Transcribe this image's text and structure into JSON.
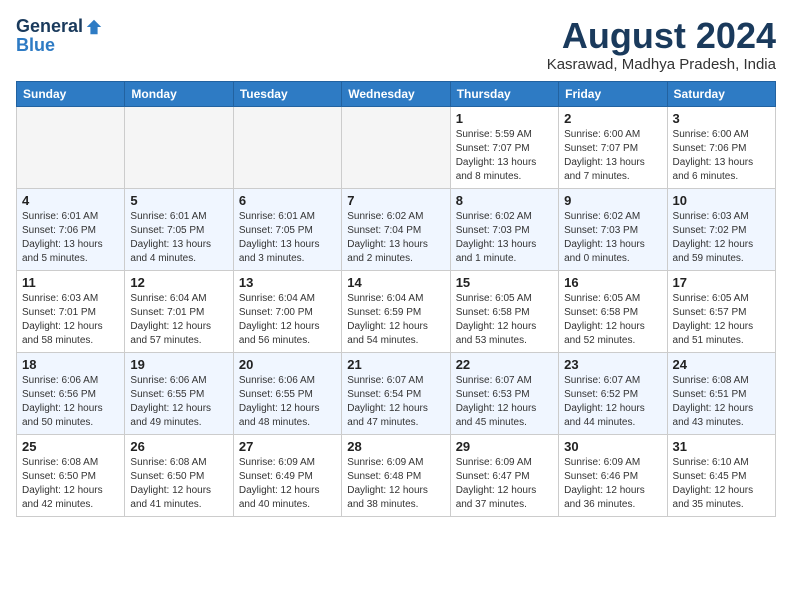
{
  "header": {
    "logo": {
      "line1": "General",
      "line2": "Blue"
    },
    "month_year": "August 2024",
    "location": "Kasrawad, Madhya Pradesh, India"
  },
  "weekdays": [
    "Sunday",
    "Monday",
    "Tuesday",
    "Wednesday",
    "Thursday",
    "Friday",
    "Saturday"
  ],
  "weeks": [
    [
      {
        "day": "",
        "info": ""
      },
      {
        "day": "",
        "info": ""
      },
      {
        "day": "",
        "info": ""
      },
      {
        "day": "",
        "info": ""
      },
      {
        "day": "1",
        "info": "Sunrise: 5:59 AM\nSunset: 7:07 PM\nDaylight: 13 hours\nand 8 minutes."
      },
      {
        "day": "2",
        "info": "Sunrise: 6:00 AM\nSunset: 7:07 PM\nDaylight: 13 hours\nand 7 minutes."
      },
      {
        "day": "3",
        "info": "Sunrise: 6:00 AM\nSunset: 7:06 PM\nDaylight: 13 hours\nand 6 minutes."
      }
    ],
    [
      {
        "day": "4",
        "info": "Sunrise: 6:01 AM\nSunset: 7:06 PM\nDaylight: 13 hours\nand 5 minutes."
      },
      {
        "day": "5",
        "info": "Sunrise: 6:01 AM\nSunset: 7:05 PM\nDaylight: 13 hours\nand 4 minutes."
      },
      {
        "day": "6",
        "info": "Sunrise: 6:01 AM\nSunset: 7:05 PM\nDaylight: 13 hours\nand 3 minutes."
      },
      {
        "day": "7",
        "info": "Sunrise: 6:02 AM\nSunset: 7:04 PM\nDaylight: 13 hours\nand 2 minutes."
      },
      {
        "day": "8",
        "info": "Sunrise: 6:02 AM\nSunset: 7:03 PM\nDaylight: 13 hours\nand 1 minute."
      },
      {
        "day": "9",
        "info": "Sunrise: 6:02 AM\nSunset: 7:03 PM\nDaylight: 13 hours\nand 0 minutes."
      },
      {
        "day": "10",
        "info": "Sunrise: 6:03 AM\nSunset: 7:02 PM\nDaylight: 12 hours\nand 59 minutes."
      }
    ],
    [
      {
        "day": "11",
        "info": "Sunrise: 6:03 AM\nSunset: 7:01 PM\nDaylight: 12 hours\nand 58 minutes."
      },
      {
        "day": "12",
        "info": "Sunrise: 6:04 AM\nSunset: 7:01 PM\nDaylight: 12 hours\nand 57 minutes."
      },
      {
        "day": "13",
        "info": "Sunrise: 6:04 AM\nSunset: 7:00 PM\nDaylight: 12 hours\nand 56 minutes."
      },
      {
        "day": "14",
        "info": "Sunrise: 6:04 AM\nSunset: 6:59 PM\nDaylight: 12 hours\nand 54 minutes."
      },
      {
        "day": "15",
        "info": "Sunrise: 6:05 AM\nSunset: 6:58 PM\nDaylight: 12 hours\nand 53 minutes."
      },
      {
        "day": "16",
        "info": "Sunrise: 6:05 AM\nSunset: 6:58 PM\nDaylight: 12 hours\nand 52 minutes."
      },
      {
        "day": "17",
        "info": "Sunrise: 6:05 AM\nSunset: 6:57 PM\nDaylight: 12 hours\nand 51 minutes."
      }
    ],
    [
      {
        "day": "18",
        "info": "Sunrise: 6:06 AM\nSunset: 6:56 PM\nDaylight: 12 hours\nand 50 minutes."
      },
      {
        "day": "19",
        "info": "Sunrise: 6:06 AM\nSunset: 6:55 PM\nDaylight: 12 hours\nand 49 minutes."
      },
      {
        "day": "20",
        "info": "Sunrise: 6:06 AM\nSunset: 6:55 PM\nDaylight: 12 hours\nand 48 minutes."
      },
      {
        "day": "21",
        "info": "Sunrise: 6:07 AM\nSunset: 6:54 PM\nDaylight: 12 hours\nand 47 minutes."
      },
      {
        "day": "22",
        "info": "Sunrise: 6:07 AM\nSunset: 6:53 PM\nDaylight: 12 hours\nand 45 minutes."
      },
      {
        "day": "23",
        "info": "Sunrise: 6:07 AM\nSunset: 6:52 PM\nDaylight: 12 hours\nand 44 minutes."
      },
      {
        "day": "24",
        "info": "Sunrise: 6:08 AM\nSunset: 6:51 PM\nDaylight: 12 hours\nand 43 minutes."
      }
    ],
    [
      {
        "day": "25",
        "info": "Sunrise: 6:08 AM\nSunset: 6:50 PM\nDaylight: 12 hours\nand 42 minutes."
      },
      {
        "day": "26",
        "info": "Sunrise: 6:08 AM\nSunset: 6:50 PM\nDaylight: 12 hours\nand 41 minutes."
      },
      {
        "day": "27",
        "info": "Sunrise: 6:09 AM\nSunset: 6:49 PM\nDaylight: 12 hours\nand 40 minutes."
      },
      {
        "day": "28",
        "info": "Sunrise: 6:09 AM\nSunset: 6:48 PM\nDaylight: 12 hours\nand 38 minutes."
      },
      {
        "day": "29",
        "info": "Sunrise: 6:09 AM\nSunset: 6:47 PM\nDaylight: 12 hours\nand 37 minutes."
      },
      {
        "day": "30",
        "info": "Sunrise: 6:09 AM\nSunset: 6:46 PM\nDaylight: 12 hours\nand 36 minutes."
      },
      {
        "day": "31",
        "info": "Sunrise: 6:10 AM\nSunset: 6:45 PM\nDaylight: 12 hours\nand 35 minutes."
      }
    ]
  ]
}
